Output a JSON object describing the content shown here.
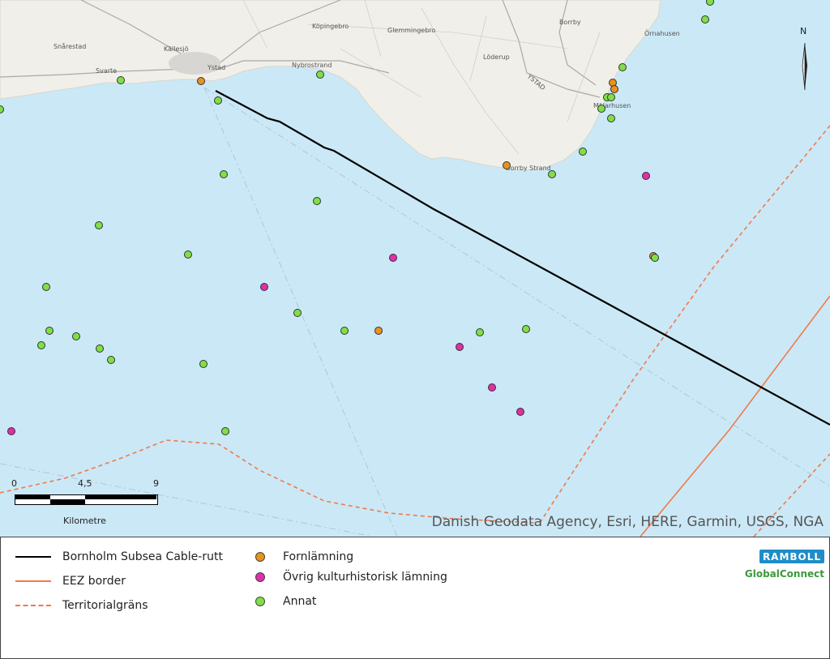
{
  "map": {
    "place_names": [
      "Snårestad",
      "Källesjö",
      "Svarte",
      "Ystad",
      "Köpingebro",
      "Glemmingebro",
      "Nybrostrand",
      "Löderup",
      "Borrby",
      "Örnahusen",
      "YSTAD",
      "Mälarhusen",
      "Borrby Strand"
    ],
    "attribution": "Danish Geodata Agency, Esri, HERE, Garmin, USGS, NGA",
    "north_label": "N",
    "scalebar": {
      "ticks": [
        "0",
        "4,5",
        "9"
      ],
      "unit": "Kilometre"
    },
    "colors": {
      "sea": "#cbe8f6",
      "land": "#f1efe9",
      "cable": "#000000",
      "eez": "#f07a4a",
      "fornlamning": "#e8921c",
      "ovrig": "#e22ea8",
      "annat": "#7fe045"
    }
  },
  "legend": {
    "cable_label": "Bornholm Subsea Cable-rutt",
    "eez_label": "EEZ border",
    "territorial_label": "Territorialgräns",
    "fornlamning_label": "Fornlämning",
    "ovrig_label": "Övrig kulturhistorisk lämning",
    "annat_label": "Annat"
  },
  "logos": {
    "ramboll": "RAMBOLL",
    "globalconnect": "GlobalConnect"
  }
}
